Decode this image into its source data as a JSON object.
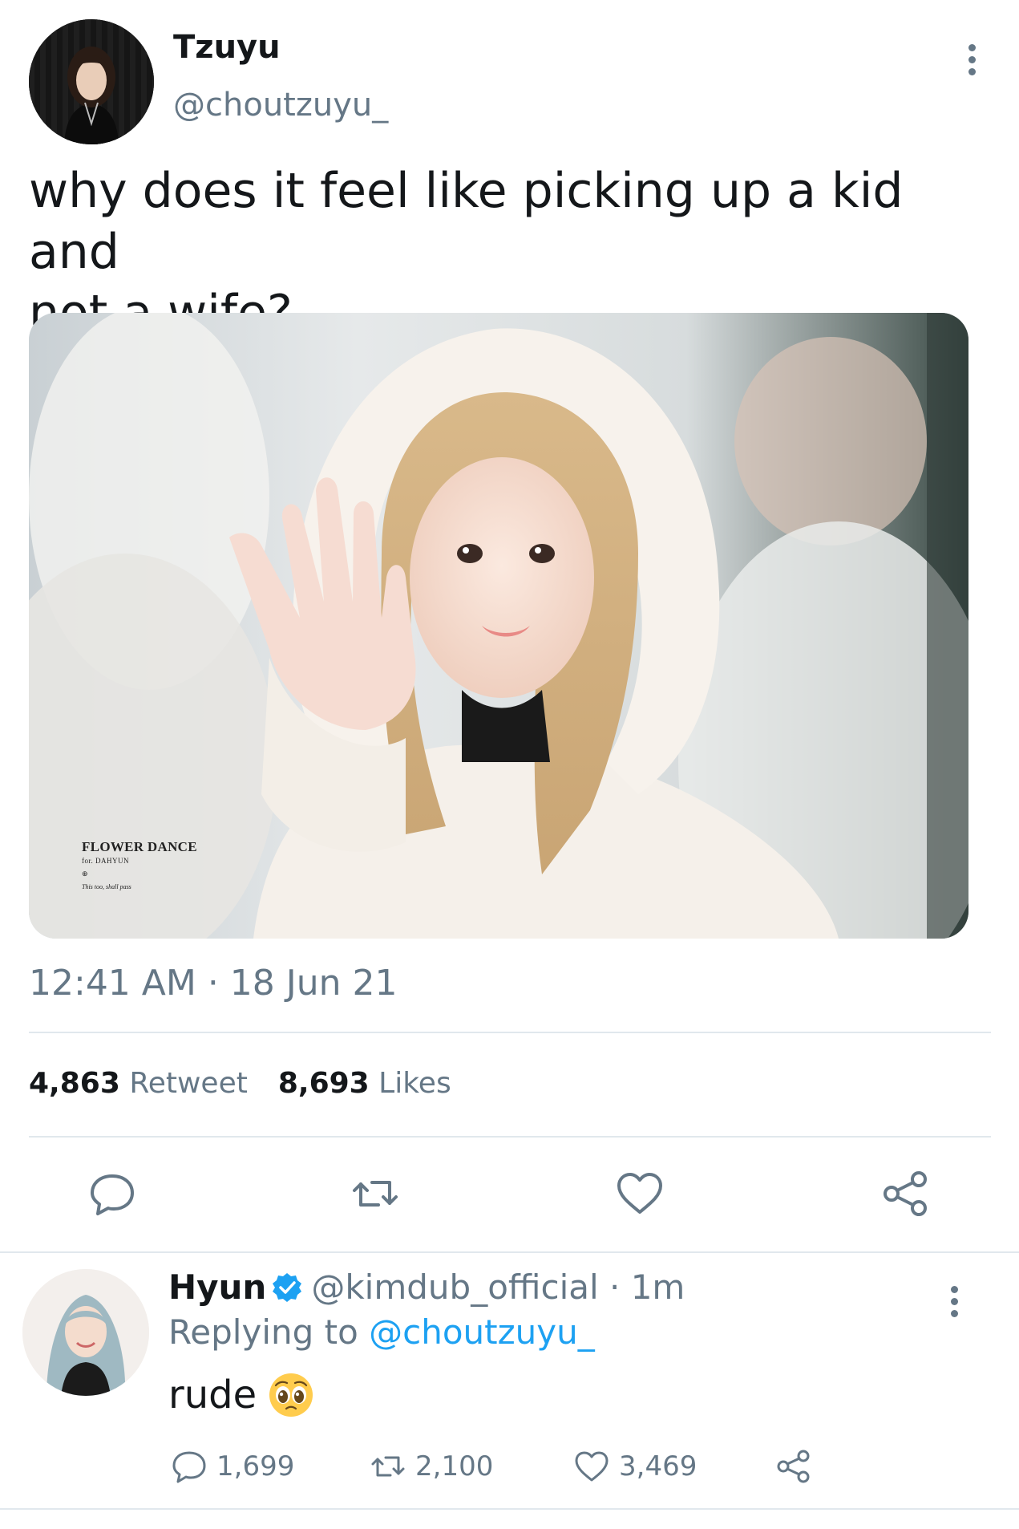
{
  "main_tweet": {
    "author": {
      "name": "Tzuyu",
      "handle": "@choutzuyu_"
    },
    "text": "why does it feel like picking up a kid and\nnot a wife?",
    "media_watermark": {
      "title": "FLOWER DANCE",
      "subtitle": "for. DAHYUN",
      "dot": "⊕",
      "tagline": "This too, shall pass"
    },
    "timestamp": "12:41 AM · 18 Jun 21",
    "stats": {
      "retweets_count": "4,863",
      "retweets_label": "Retweet",
      "likes_count": "8,693",
      "likes_label": "Likes"
    },
    "actions": [
      "reply-icon",
      "retweet-icon",
      "like-icon",
      "share-icon"
    ]
  },
  "reply": {
    "author": {
      "name": "Hyun",
      "verified": true,
      "handle": "@kimdub_official"
    },
    "time": " · 1m",
    "replying_prefix": "Replying to ",
    "replying_to": "@choutzuyu_",
    "text": "rude",
    "emoji": "pleading-face-emoji",
    "counts": {
      "replies": "1,699",
      "retweets": "2,100",
      "likes": "3,469"
    }
  },
  "colors": {
    "text_primary": "#14171a",
    "text_secondary": "#657786",
    "link": "#1da1f2",
    "divider": "#e1e8ed",
    "verified_badge": "#1da1f2"
  }
}
